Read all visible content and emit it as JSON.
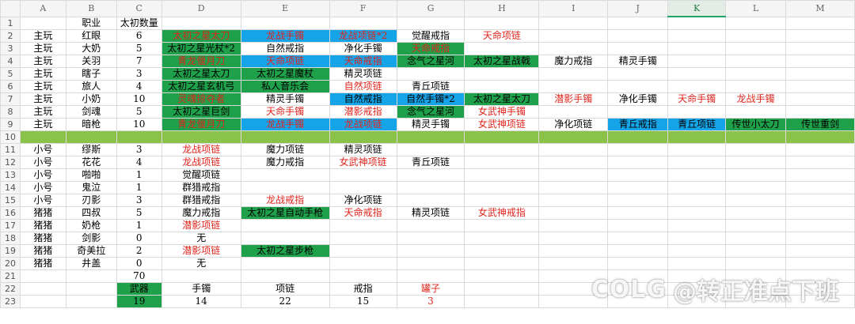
{
  "sheet": {
    "columns": [
      "A",
      "B",
      "C",
      "D",
      "E",
      "F",
      "G",
      "H",
      "I",
      "J",
      "K",
      "L",
      "M"
    ],
    "selected_column": "K",
    "rows": [
      {
        "n": "1",
        "cells": [
          {
            "t": ""
          },
          {
            "t": "职业"
          },
          {
            "t": "太初数量"
          },
          {
            "t": ""
          },
          {
            "t": ""
          },
          {
            "t": ""
          },
          {
            "t": ""
          },
          {
            "t": ""
          },
          {
            "t": ""
          },
          {
            "t": ""
          },
          {
            "t": ""
          },
          {
            "t": ""
          },
          {
            "t": ""
          }
        ]
      },
      {
        "n": "2",
        "cells": [
          {
            "t": "主玩"
          },
          {
            "t": "红眼"
          },
          {
            "t": "6"
          },
          {
            "t": "太初之星太刀",
            "bg": "green",
            "fg": "red"
          },
          {
            "t": "龙战手镯",
            "bg": "blue",
            "fg": "red"
          },
          {
            "t": "龙战项链*2",
            "bg": "blue",
            "fg": "red"
          },
          {
            "t": "觉醒戒指"
          },
          {
            "t": "天命项链",
            "fg": "red"
          },
          {
            "t": ""
          },
          {
            "t": ""
          },
          {
            "t": ""
          },
          {
            "t": ""
          },
          {
            "t": ""
          }
        ]
      },
      {
        "n": "3",
        "cells": [
          {
            "t": "主玩"
          },
          {
            "t": "大奶"
          },
          {
            "t": "5"
          },
          {
            "t": "太初之星光杖*2",
            "bg": "green",
            "fg": "black"
          },
          {
            "t": "自然戒指"
          },
          {
            "t": "净化手镯"
          },
          {
            "t": "天命戒指",
            "bg": "green",
            "fg": "red"
          },
          {
            "t": ""
          },
          {
            "t": ""
          },
          {
            "t": ""
          },
          {
            "t": ""
          },
          {
            "t": ""
          },
          {
            "t": ""
          }
        ]
      },
      {
        "n": "4",
        "cells": [
          {
            "t": "主玩"
          },
          {
            "t": "关羽"
          },
          {
            "t": "7"
          },
          {
            "t": "青龙偃月刀",
            "bg": "green",
            "fg": "red"
          },
          {
            "t": "天命项链",
            "bg": "blue",
            "fg": "red"
          },
          {
            "t": "天命戒指",
            "bg": "blue",
            "fg": "red"
          },
          {
            "t": "念气之星河",
            "bg": "green",
            "fg": "black"
          },
          {
            "t": "太初之星战戟",
            "bg": "green",
            "fg": "black"
          },
          {
            "t": "魔力戒指"
          },
          {
            "t": "精灵手镯"
          },
          {
            "t": ""
          },
          {
            "t": ""
          },
          {
            "t": ""
          }
        ]
      },
      {
        "n": "5",
        "cells": [
          {
            "t": "主玩"
          },
          {
            "t": "瞎子"
          },
          {
            "t": "3"
          },
          {
            "t": "太初之星太刀",
            "bg": "green",
            "fg": "black"
          },
          {
            "t": "太初之星魔杖",
            "bg": "green",
            "fg": "black"
          },
          {
            "t": "精灵项链"
          },
          {
            "t": ""
          },
          {
            "t": ""
          },
          {
            "t": ""
          },
          {
            "t": ""
          },
          {
            "t": ""
          },
          {
            "t": ""
          },
          {
            "t": ""
          }
        ]
      },
      {
        "n": "6",
        "cells": [
          {
            "t": "主玩"
          },
          {
            "t": "旅人"
          },
          {
            "t": "4"
          },
          {
            "t": "太初之星玄机弓",
            "bg": "green",
            "fg": "black"
          },
          {
            "t": "私人音乐会",
            "bg": "green",
            "fg": "black"
          },
          {
            "t": "自然项链",
            "fg": "red"
          },
          {
            "t": "青丘项链"
          },
          {
            "t": ""
          },
          {
            "t": ""
          },
          {
            "t": ""
          },
          {
            "t": ""
          },
          {
            "t": ""
          },
          {
            "t": ""
          }
        ]
      },
      {
        "n": "7",
        "cells": [
          {
            "t": "主玩"
          },
          {
            "t": "小奶"
          },
          {
            "t": "10"
          },
          {
            "t": "灵魂掠夺者",
            "bg": "green",
            "fg": "red"
          },
          {
            "t": "精灵手镯"
          },
          {
            "t": "自然戒指",
            "bg": "blue",
            "fg": "black"
          },
          {
            "t": "自然手镯*2",
            "bg": "blue",
            "fg": "black"
          },
          {
            "t": "太初之星太刀",
            "bg": "green",
            "fg": "black"
          },
          {
            "t": "潜影手镯",
            "fg": "red"
          },
          {
            "t": "净化手镯"
          },
          {
            "t": "天命手镯",
            "fg": "red"
          },
          {
            "t": "龙战手镯",
            "fg": "red"
          },
          {
            "t": ""
          }
        ]
      },
      {
        "n": "8",
        "cells": [
          {
            "t": "主玩"
          },
          {
            "t": "剑魂"
          },
          {
            "t": "5"
          },
          {
            "t": "太初之星巨剑",
            "bg": "green",
            "fg": "black"
          },
          {
            "t": "天命手镯",
            "fg": "red"
          },
          {
            "t": "潜影戒指",
            "fg": "red"
          },
          {
            "t": "念气之星河",
            "bg": "green",
            "fg": "black"
          },
          {
            "t": "女武神手镯",
            "fg": "red"
          },
          {
            "t": ""
          },
          {
            "t": ""
          },
          {
            "t": ""
          },
          {
            "t": ""
          },
          {
            "t": ""
          }
        ]
      },
      {
        "n": "9",
        "cells": [
          {
            "t": "主玩"
          },
          {
            "t": "暗枪"
          },
          {
            "t": "10"
          },
          {
            "t": "青龙偃月刀",
            "bg": "green",
            "fg": "red"
          },
          {
            "t": "龙战手镯",
            "bg": "blue",
            "fg": "red"
          },
          {
            "t": "龙战项链",
            "bg": "blue",
            "fg": "red"
          },
          {
            "t": "精灵手镯"
          },
          {
            "t": "女武神项链",
            "fg": "red"
          },
          {
            "t": "净化项链"
          },
          {
            "t": "青丘戒指",
            "bg": "blue",
            "fg": "black"
          },
          {
            "t": "青丘项链",
            "bg": "blue",
            "fg": "black"
          },
          {
            "t": "传世小太刀",
            "bg": "green",
            "fg": "black"
          },
          {
            "t": "传世重剑",
            "bg": "green",
            "fg": "black"
          }
        ]
      },
      {
        "n": "10",
        "separator": true,
        "cells": [
          {
            "t": ""
          },
          {
            "t": ""
          },
          {
            "t": ""
          },
          {
            "t": ""
          },
          {
            "t": ""
          },
          {
            "t": ""
          },
          {
            "t": ""
          },
          {
            "t": ""
          },
          {
            "t": ""
          },
          {
            "t": ""
          },
          {
            "t": ""
          },
          {
            "t": ""
          },
          {
            "t": ""
          }
        ]
      },
      {
        "n": "11",
        "cells": [
          {
            "t": "小号"
          },
          {
            "t": "缪斯"
          },
          {
            "t": "3"
          },
          {
            "t": "龙战项链",
            "fg": "red"
          },
          {
            "t": "魔力项链"
          },
          {
            "t": "精灵项链"
          },
          {
            "t": ""
          },
          {
            "t": ""
          },
          {
            "t": ""
          },
          {
            "t": ""
          },
          {
            "t": ""
          },
          {
            "t": ""
          },
          {
            "t": ""
          }
        ]
      },
      {
        "n": "12",
        "cells": [
          {
            "t": "小号"
          },
          {
            "t": "花花"
          },
          {
            "t": "4"
          },
          {
            "t": "龙战项链",
            "fg": "red"
          },
          {
            "t": "魔力戒指"
          },
          {
            "t": "女武神项链",
            "fg": "red"
          },
          {
            "t": "青丘项链"
          },
          {
            "t": ""
          },
          {
            "t": ""
          },
          {
            "t": ""
          },
          {
            "t": ""
          },
          {
            "t": ""
          },
          {
            "t": ""
          }
        ]
      },
      {
        "n": "13",
        "cells": [
          {
            "t": "小号"
          },
          {
            "t": "啪啪"
          },
          {
            "t": "1"
          },
          {
            "t": "觉醒项链"
          },
          {
            "t": ""
          },
          {
            "t": ""
          },
          {
            "t": ""
          },
          {
            "t": ""
          },
          {
            "t": ""
          },
          {
            "t": ""
          },
          {
            "t": ""
          },
          {
            "t": ""
          },
          {
            "t": ""
          }
        ]
      },
      {
        "n": "14",
        "cells": [
          {
            "t": "小号"
          },
          {
            "t": "鬼泣"
          },
          {
            "t": "1"
          },
          {
            "t": "群猎戒指"
          },
          {
            "t": ""
          },
          {
            "t": ""
          },
          {
            "t": ""
          },
          {
            "t": ""
          },
          {
            "t": ""
          },
          {
            "t": ""
          },
          {
            "t": ""
          },
          {
            "t": ""
          },
          {
            "t": ""
          }
        ]
      },
      {
        "n": "15",
        "cells": [
          {
            "t": "小号"
          },
          {
            "t": "刃影"
          },
          {
            "t": "3"
          },
          {
            "t": "群猎戒指"
          },
          {
            "t": "龙战戒指",
            "fg": "red"
          },
          {
            "t": "净化项链"
          },
          {
            "t": ""
          },
          {
            "t": ""
          },
          {
            "t": ""
          },
          {
            "t": ""
          },
          {
            "t": ""
          },
          {
            "t": ""
          },
          {
            "t": ""
          }
        ]
      },
      {
        "n": "16",
        "cells": [
          {
            "t": "猪猪"
          },
          {
            "t": "四叔"
          },
          {
            "t": "5"
          },
          {
            "t": "魔力戒指"
          },
          {
            "t": "太初之星自动手枪",
            "bg": "green",
            "fg": "black"
          },
          {
            "t": "天命戒指",
            "fg": "red"
          },
          {
            "t": "精灵项链"
          },
          {
            "t": "女武神戒指",
            "fg": "red"
          },
          {
            "t": ""
          },
          {
            "t": ""
          },
          {
            "t": ""
          },
          {
            "t": ""
          },
          {
            "t": ""
          }
        ]
      },
      {
        "n": "17",
        "cells": [
          {
            "t": "猪猪"
          },
          {
            "t": "奶枪"
          },
          {
            "t": "1"
          },
          {
            "t": "潜影项链",
            "fg": "red"
          },
          {
            "t": ""
          },
          {
            "t": ""
          },
          {
            "t": ""
          },
          {
            "t": ""
          },
          {
            "t": ""
          },
          {
            "t": ""
          },
          {
            "t": ""
          },
          {
            "t": ""
          },
          {
            "t": ""
          }
        ]
      },
      {
        "n": "18",
        "cells": [
          {
            "t": "猪猪"
          },
          {
            "t": "剑影"
          },
          {
            "t": "0"
          },
          {
            "t": "无"
          },
          {
            "t": ""
          },
          {
            "t": ""
          },
          {
            "t": ""
          },
          {
            "t": ""
          },
          {
            "t": ""
          },
          {
            "t": ""
          },
          {
            "t": ""
          },
          {
            "t": ""
          },
          {
            "t": ""
          }
        ]
      },
      {
        "n": "19",
        "cells": [
          {
            "t": "猪猪"
          },
          {
            "t": "奇美拉"
          },
          {
            "t": "2"
          },
          {
            "t": "潜影项链",
            "fg": "red"
          },
          {
            "t": "太初之星步枪",
            "bg": "green",
            "fg": "black"
          },
          {
            "t": ""
          },
          {
            "t": ""
          },
          {
            "t": ""
          },
          {
            "t": ""
          },
          {
            "t": ""
          },
          {
            "t": ""
          },
          {
            "t": ""
          },
          {
            "t": ""
          }
        ]
      },
      {
        "n": "20",
        "cells": [
          {
            "t": "猪猪"
          },
          {
            "t": "井盖"
          },
          {
            "t": "0"
          },
          {
            "t": "无"
          },
          {
            "t": ""
          },
          {
            "t": ""
          },
          {
            "t": ""
          },
          {
            "t": ""
          },
          {
            "t": ""
          },
          {
            "t": ""
          },
          {
            "t": ""
          },
          {
            "t": ""
          },
          {
            "t": ""
          }
        ]
      },
      {
        "n": "21",
        "cells": [
          {
            "t": ""
          },
          {
            "t": ""
          },
          {
            "t": "70"
          },
          {
            "t": ""
          },
          {
            "t": ""
          },
          {
            "t": ""
          },
          {
            "t": ""
          },
          {
            "t": ""
          },
          {
            "t": ""
          },
          {
            "t": ""
          },
          {
            "t": ""
          },
          {
            "t": ""
          },
          {
            "t": ""
          }
        ]
      },
      {
        "n": "22",
        "cells": [
          {
            "t": ""
          },
          {
            "t": ""
          },
          {
            "t": "武器",
            "bg": "green",
            "fg": "black"
          },
          {
            "t": "手镯"
          },
          {
            "t": "项链"
          },
          {
            "t": "戒指"
          },
          {
            "t": "罐子",
            "fg": "red"
          },
          {
            "t": ""
          },
          {
            "t": ""
          },
          {
            "t": ""
          },
          {
            "t": ""
          },
          {
            "t": ""
          },
          {
            "t": ""
          }
        ]
      },
      {
        "n": "23",
        "cells": [
          {
            "t": ""
          },
          {
            "t": ""
          },
          {
            "t": "19",
            "bg": "green",
            "fg": "black"
          },
          {
            "t": "14"
          },
          {
            "t": "22"
          },
          {
            "t": "15"
          },
          {
            "t": "3",
            "fg": "red"
          },
          {
            "t": ""
          },
          {
            "t": ""
          },
          {
            "t": ""
          },
          {
            "t": ""
          },
          {
            "t": ""
          },
          {
            "t": ""
          }
        ]
      }
    ]
  },
  "colors": {
    "green": "#1fa04a",
    "blue": "#16a4e8",
    "red": "#e0241c",
    "separator": "#8bc34a"
  },
  "watermark": {
    "logo": "COLG",
    "handle": "@转正准点下班"
  }
}
